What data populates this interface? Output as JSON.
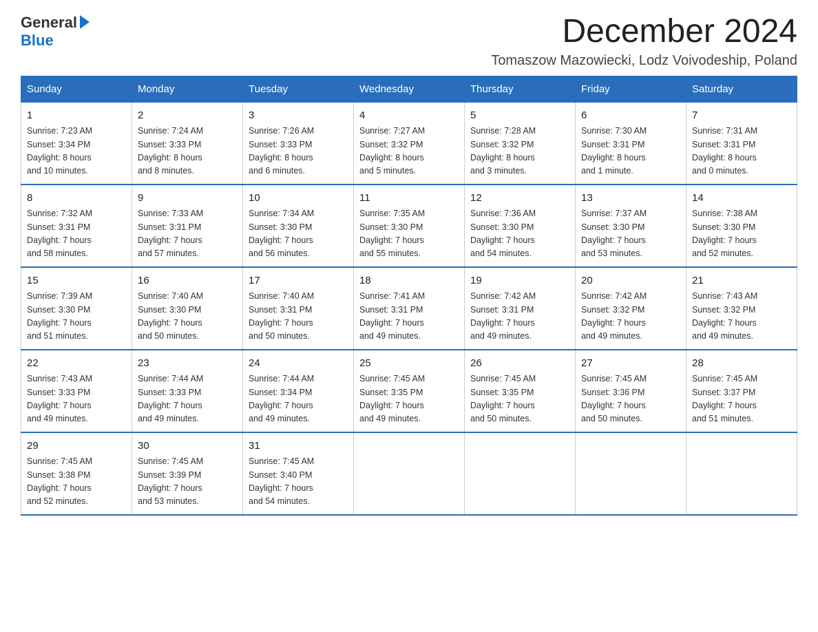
{
  "logo": {
    "general": "General",
    "blue": "Blue"
  },
  "title": "December 2024",
  "location": "Tomaszow Mazowiecki, Lodz Voivodeship, Poland",
  "days_of_week": [
    "Sunday",
    "Monday",
    "Tuesday",
    "Wednesday",
    "Thursday",
    "Friday",
    "Saturday"
  ],
  "weeks": [
    [
      {
        "day": "1",
        "sunrise": "7:23 AM",
        "sunset": "3:34 PM",
        "daylight": "8 hours and 10 minutes."
      },
      {
        "day": "2",
        "sunrise": "7:24 AM",
        "sunset": "3:33 PM",
        "daylight": "8 hours and 8 minutes."
      },
      {
        "day": "3",
        "sunrise": "7:26 AM",
        "sunset": "3:33 PM",
        "daylight": "8 hours and 6 minutes."
      },
      {
        "day": "4",
        "sunrise": "7:27 AM",
        "sunset": "3:32 PM",
        "daylight": "8 hours and 5 minutes."
      },
      {
        "day": "5",
        "sunrise": "7:28 AM",
        "sunset": "3:32 PM",
        "daylight": "8 hours and 3 minutes."
      },
      {
        "day": "6",
        "sunrise": "7:30 AM",
        "sunset": "3:31 PM",
        "daylight": "8 hours and 1 minute."
      },
      {
        "day": "7",
        "sunrise": "7:31 AM",
        "sunset": "3:31 PM",
        "daylight": "8 hours and 0 minutes."
      }
    ],
    [
      {
        "day": "8",
        "sunrise": "7:32 AM",
        "sunset": "3:31 PM",
        "daylight": "7 hours and 58 minutes."
      },
      {
        "day": "9",
        "sunrise": "7:33 AM",
        "sunset": "3:31 PM",
        "daylight": "7 hours and 57 minutes."
      },
      {
        "day": "10",
        "sunrise": "7:34 AM",
        "sunset": "3:30 PM",
        "daylight": "7 hours and 56 minutes."
      },
      {
        "day": "11",
        "sunrise": "7:35 AM",
        "sunset": "3:30 PM",
        "daylight": "7 hours and 55 minutes."
      },
      {
        "day": "12",
        "sunrise": "7:36 AM",
        "sunset": "3:30 PM",
        "daylight": "7 hours and 54 minutes."
      },
      {
        "day": "13",
        "sunrise": "7:37 AM",
        "sunset": "3:30 PM",
        "daylight": "7 hours and 53 minutes."
      },
      {
        "day": "14",
        "sunrise": "7:38 AM",
        "sunset": "3:30 PM",
        "daylight": "7 hours and 52 minutes."
      }
    ],
    [
      {
        "day": "15",
        "sunrise": "7:39 AM",
        "sunset": "3:30 PM",
        "daylight": "7 hours and 51 minutes."
      },
      {
        "day": "16",
        "sunrise": "7:40 AM",
        "sunset": "3:30 PM",
        "daylight": "7 hours and 50 minutes."
      },
      {
        "day": "17",
        "sunrise": "7:40 AM",
        "sunset": "3:31 PM",
        "daylight": "7 hours and 50 minutes."
      },
      {
        "day": "18",
        "sunrise": "7:41 AM",
        "sunset": "3:31 PM",
        "daylight": "7 hours and 49 minutes."
      },
      {
        "day": "19",
        "sunrise": "7:42 AM",
        "sunset": "3:31 PM",
        "daylight": "7 hours and 49 minutes."
      },
      {
        "day": "20",
        "sunrise": "7:42 AM",
        "sunset": "3:32 PM",
        "daylight": "7 hours and 49 minutes."
      },
      {
        "day": "21",
        "sunrise": "7:43 AM",
        "sunset": "3:32 PM",
        "daylight": "7 hours and 49 minutes."
      }
    ],
    [
      {
        "day": "22",
        "sunrise": "7:43 AM",
        "sunset": "3:33 PM",
        "daylight": "7 hours and 49 minutes."
      },
      {
        "day": "23",
        "sunrise": "7:44 AM",
        "sunset": "3:33 PM",
        "daylight": "7 hours and 49 minutes."
      },
      {
        "day": "24",
        "sunrise": "7:44 AM",
        "sunset": "3:34 PM",
        "daylight": "7 hours and 49 minutes."
      },
      {
        "day": "25",
        "sunrise": "7:45 AM",
        "sunset": "3:35 PM",
        "daylight": "7 hours and 49 minutes."
      },
      {
        "day": "26",
        "sunrise": "7:45 AM",
        "sunset": "3:35 PM",
        "daylight": "7 hours and 50 minutes."
      },
      {
        "day": "27",
        "sunrise": "7:45 AM",
        "sunset": "3:36 PM",
        "daylight": "7 hours and 50 minutes."
      },
      {
        "day": "28",
        "sunrise": "7:45 AM",
        "sunset": "3:37 PM",
        "daylight": "7 hours and 51 minutes."
      }
    ],
    [
      {
        "day": "29",
        "sunrise": "7:45 AM",
        "sunset": "3:38 PM",
        "daylight": "7 hours and 52 minutes."
      },
      {
        "day": "30",
        "sunrise": "7:45 AM",
        "sunset": "3:39 PM",
        "daylight": "7 hours and 53 minutes."
      },
      {
        "day": "31",
        "sunrise": "7:45 AM",
        "sunset": "3:40 PM",
        "daylight": "7 hours and 54 minutes."
      },
      null,
      null,
      null,
      null
    ]
  ],
  "labels": {
    "sunrise": "Sunrise:",
    "sunset": "Sunset:",
    "daylight": "Daylight:"
  }
}
